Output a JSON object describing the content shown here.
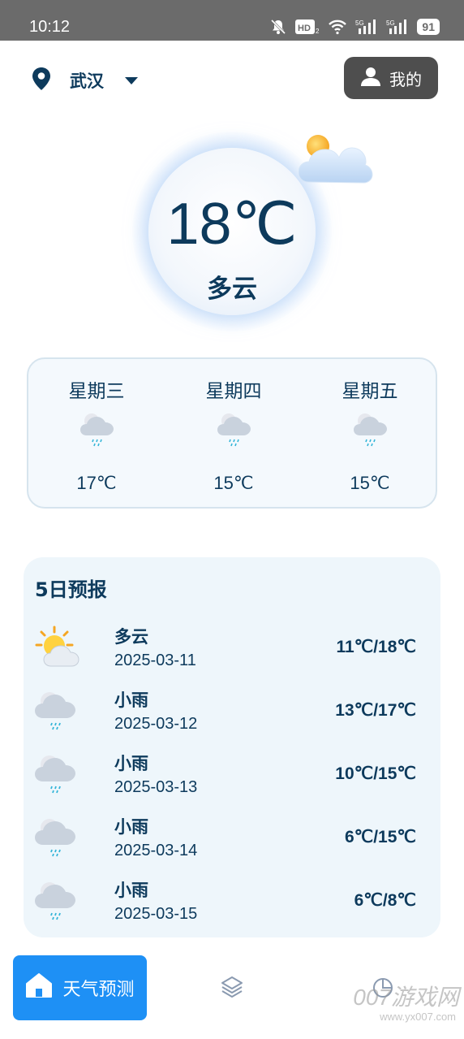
{
  "status_bar": {
    "time": "10:12",
    "battery": "91",
    "icons": [
      "bell-off-icon",
      "hd-icon",
      "wifi-icon",
      "signal-5g-icon",
      "signal-5g-icon",
      "battery-icon"
    ]
  },
  "header": {
    "location": "武汉",
    "location_icon": "location-pin-icon",
    "mine_label": "我的",
    "mine_icon": "user-icon"
  },
  "current": {
    "temperature": "18℃",
    "condition": "多云",
    "icon": "partly-cloudy-icon"
  },
  "three_day": [
    {
      "day": "星期三",
      "temp": "17℃",
      "icon": "light-rain-icon"
    },
    {
      "day": "星期四",
      "temp": "15℃",
      "icon": "light-rain-icon"
    },
    {
      "day": "星期五",
      "temp": "15℃",
      "icon": "light-rain-icon"
    }
  ],
  "forecast": {
    "title": "5日预报",
    "items": [
      {
        "condition": "多云",
        "date": "2025-03-11",
        "range": "11℃/18℃",
        "icon": "sun-cloud-icon"
      },
      {
        "condition": "小雨",
        "date": "2025-03-12",
        "range": "13℃/17℃",
        "icon": "light-rain-icon"
      },
      {
        "condition": "小雨",
        "date": "2025-03-13",
        "range": "10℃/15℃",
        "icon": "light-rain-icon"
      },
      {
        "condition": "小雨",
        "date": "2025-03-14",
        "range": "6℃/15℃",
        "icon": "light-rain-icon"
      },
      {
        "condition": "小雨",
        "date": "2025-03-15",
        "range": "6℃/8℃",
        "icon": "light-rain-icon"
      }
    ]
  },
  "nav": {
    "home_label": "天气预测",
    "home_icon": "home-icon",
    "layers_icon": "layers-icon",
    "chart_icon": "pie-chart-icon"
  },
  "watermark": {
    "text": "007游戏网",
    "sub": "www.yx007.com"
  },
  "colors": {
    "primary_text": "#0d3a5c",
    "accent": "#1e90f5",
    "status_bar": "#6b6b6b",
    "mine_button": "#4e4e4e"
  }
}
